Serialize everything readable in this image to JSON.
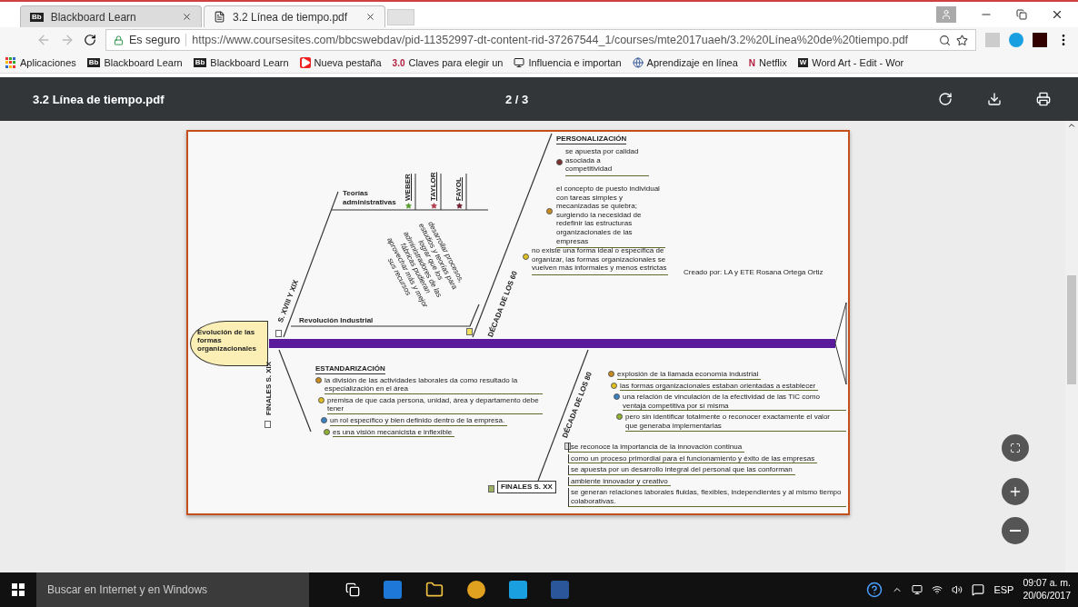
{
  "browser": {
    "tabs": [
      {
        "title": "Blackboard Learn",
        "badge": "Bb",
        "selected": false
      },
      {
        "title": "3.2 Línea de tiempo.pdf",
        "selected": true
      }
    ],
    "address": {
      "secure_label": "Es seguro",
      "url": "https://www.coursesites.com/bbcswebdav/pid-11352997-dt-content-rid-37267544_1/courses/mte2017uaeh/3.2%20Línea%20de%20tiempo.pdf"
    },
    "bookmarks": [
      {
        "label": "Aplicaciones",
        "kind": "apps"
      },
      {
        "label": "Blackboard Learn",
        "kind": "badge",
        "badge": "Bb"
      },
      {
        "label": "Blackboard Learn",
        "kind": "badge",
        "badge": "Bb"
      },
      {
        "label": "Nueva pestaña",
        "kind": "video"
      },
      {
        "label": "Claves para elegir un",
        "kind": "text",
        "badge": "3.0"
      },
      {
        "label": "Influencia e importan",
        "kind": "owl"
      },
      {
        "label": "Aprendizaje en línea",
        "kind": "globe"
      },
      {
        "label": "Netflix",
        "kind": "text",
        "badge": "N"
      },
      {
        "label": "Word Art - Edit - Wor",
        "kind": "badge",
        "badge": "W"
      }
    ]
  },
  "pdf_viewer": {
    "title": "3.2 Línea de tiempo.pdf",
    "page_indicator": "2 / 3"
  },
  "diagram": {
    "title": "Evolución de las formas organizacionales",
    "credit": "Creado por: LA y ETE Rosana Ortega Ortiz",
    "s18_19": {
      "label": "S. XVIII Y XIX",
      "theories": {
        "label": "Teorías administrativas",
        "authors": [
          "WEBER",
          "TAYLOR",
          "FAYOL"
        ]
      },
      "revolution": {
        "label": "Revolución Industrial",
        "note": "desarrollar procesos, estudios y teorías para lograr que los administradores de las fábricas pudieran aprovechar más y mejor sus recursos"
      }
    },
    "s19_end": {
      "label": "FINALES S. XIX",
      "branch": "ESTANDARIZACIÓN",
      "points": [
        "la división de las actividades laborales da como resultado la especialización en el área",
        "premisa de que cada persona, unidad, área y departamento debe tener",
        "un rol específico y bien definido dentro de la empresa.",
        "es una visión mecanicista e inflexible"
      ]
    },
    "d60": {
      "label": "DÉCADA DE LOS 60",
      "branch": "PERSONALIZACIÓN",
      "points": [
        "se apuesta por calidad asociada a competitividad",
        "el concepto de puesto individual con tareas simples y mecanizadas se quiebra; surgiendo la necesidad de redefinir las estructuras organizacionales de las empresas",
        "no existe una forma ideal o específica de organizar, las formas organizacionales se vuelven más informales y menos estrictas"
      ]
    },
    "d80": {
      "label": "DÉCADA DE LOS 80",
      "points": [
        "explosión de la llamada economía industrial",
        "las formas organizacionales estaban orientadas a establecer",
        "una relación de vinculación de la efectividad de las TIC como ventaja competitiva por sí misma",
        "pero sin identificar totalmente o reconocer exactamente el valor que generaba implementarlas"
      ]
    },
    "s20_end": {
      "label": "FINALES S. XX",
      "points": [
        "se reconoce la importancia de la innovación continua",
        "como un proceso primordial para el funcionamiento y éxito de las empresas",
        "se apuesta por un desarrollo integral del personal que las conforman",
        "ambiente innovador y creativo",
        "se generan relaciones laborales fluidas, flexibles, independientes y al mismo tiempo colaborativas."
      ]
    }
  },
  "taskbar": {
    "search_placeholder": "Buscar en Internet y en Windows",
    "language": "ESP",
    "time": "09:07 a. m.",
    "date": "20/06/2017"
  }
}
